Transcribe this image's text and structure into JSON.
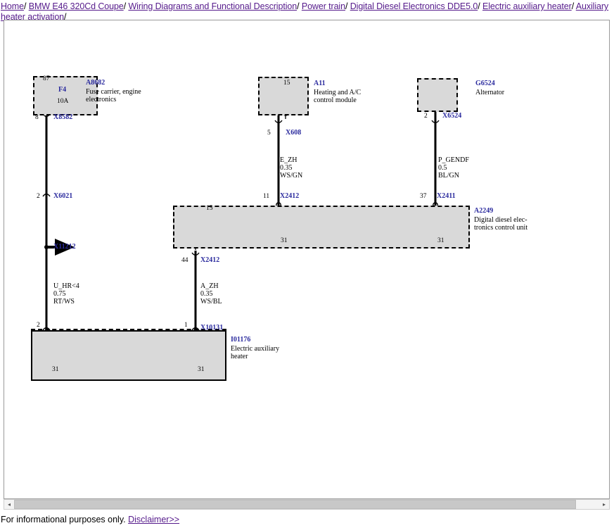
{
  "breadcrumb": {
    "items": [
      {
        "label": "Home",
        "link": true
      },
      {
        "label": "BMW E46 320Cd Coupe",
        "link": true
      },
      {
        "label": "Wiring Diagrams and Functional Description",
        "link": true
      },
      {
        "label": "Power train",
        "link": true
      },
      {
        "label": "Digital Diesel Electronics DDE5.0",
        "link": true
      },
      {
        "label": "Electric auxiliary heater",
        "link": true
      },
      {
        "label": "Auxiliary heater activation",
        "link": true
      }
    ],
    "separator": "/"
  },
  "footer": {
    "text": "For informational purposes only.",
    "disclaimer_label": "Disclaimer>>"
  },
  "scrollbar": {
    "left_arrow": "◂",
    "right_arrow": "▸"
  },
  "diagram": {
    "title": "Auxiliary heater activation",
    "colors": {
      "id_blue": "#2b2b9e",
      "component_fill": "#d9d9d9",
      "wire_black": "#000000",
      "link_purple": "#551a8b"
    },
    "components": [
      {
        "id": "A8682",
        "description": "Fuse carrier, engine\nelectronics",
        "internal_terminal": "87",
        "fuse_name": "F4",
        "fuse_rating": "10A",
        "out_pin": "8",
        "out_connector": "X8582"
      },
      {
        "id": "A11",
        "description": "Heating and A/C\ncontrol module",
        "internal_terminal": "15",
        "out_pin": "5",
        "out_connector": "X608"
      },
      {
        "id": "G6524",
        "description": "Alternator",
        "out_pin": "2",
        "out_connector": "X6524"
      },
      {
        "id": "A2249",
        "description": "Digital diesel elec-\ntronics control unit",
        "in_pin_left": "11",
        "in_connector_left": "X2412",
        "in_pin_right": "37",
        "in_connector_right": "X2411",
        "out_pin": "44",
        "out_connector": "X2412",
        "internal_terminal": "15",
        "ground_terminal_a": "31",
        "ground_terminal_b": "31"
      },
      {
        "id": "I01176",
        "description": "Electric auxiliary\nheater",
        "in_pin_left": "2",
        "in_pin_right": "1",
        "in_connector": "X10131",
        "ground_terminal_a": "31",
        "ground_terminal_b": "31"
      }
    ],
    "wires": [
      {
        "name": "U_HR<4",
        "cross_section": "0.75",
        "color_code": "RT/WS",
        "top_pin": "2",
        "top_connector": "X6021",
        "branch_connector": "X11212",
        "bottom_pin": "2"
      },
      {
        "name": "E_ZH",
        "cross_section": "0.35",
        "color_code": "WS/GN"
      },
      {
        "name": "P_GENDF",
        "cross_section": "0.5",
        "color_code": "BL/GN"
      },
      {
        "name": "A_ZH",
        "cross_section": "0.35",
        "color_code": "WS/BL",
        "bottom_pin": "1",
        "bottom_connector": "X10131"
      }
    ]
  }
}
